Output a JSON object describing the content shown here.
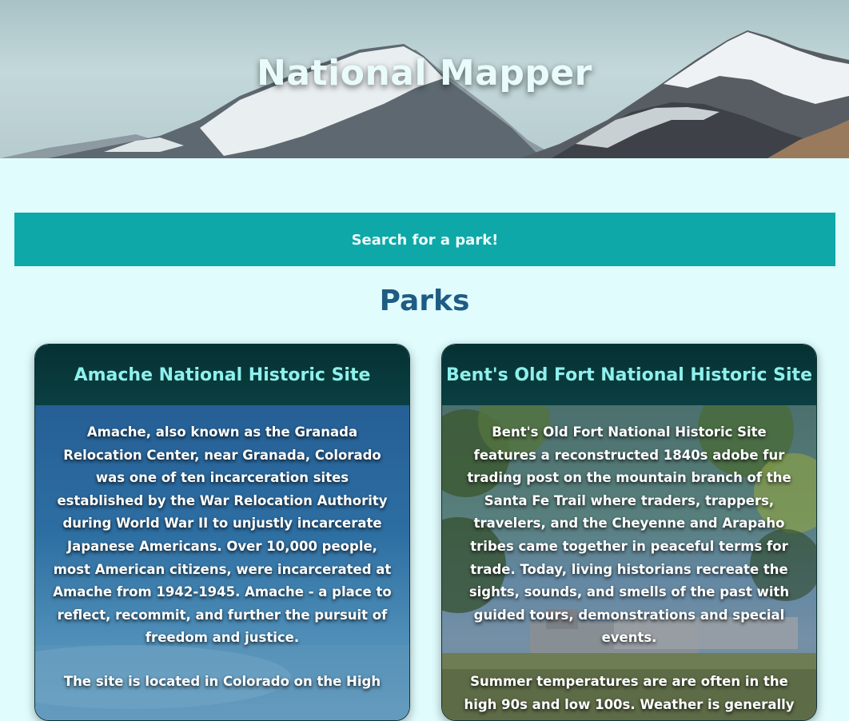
{
  "header": {
    "title": "National Mapper"
  },
  "search": {
    "label": "Search for a park!"
  },
  "parks_section": {
    "heading": "Parks"
  },
  "parks": [
    {
      "name": "Amache National Historic Site",
      "paragraphs": [
        "Amache, also known as the Granada Relocation Center, near Granada, Colorado was one of ten incarceration sites established by the War Relocation Authority during World War II to unjustly incarcerate Japanese Americans. Over 10,000 people, most American citizens, were incarcerated at Amache from 1942-1945. Amache - a place to reflect, recommit, and further the pursuit of freedom and justice.",
        "The site is located in Colorado on the High"
      ]
    },
    {
      "name": "Bent's Old Fort National Historic Site",
      "paragraphs": [
        "Bent's Old Fort National Historic Site features a reconstructed 1840s adobe fur trading post on the mountain branch of the Santa Fe Trail where traders, trappers, travelers, and the Cheyenne and Arapaho tribes came together in peaceful terms for trade. Today, living historians recreate the sights, sounds, and smells of the past with guided tours, demonstrations and special events.",
        "Summer temperatures are are often in the high 90s and low 100s. Weather is generally"
      ]
    }
  ],
  "colors": {
    "page_bg": "#e0fcfd",
    "search_bg": "#0da8a7",
    "section_heading": "#1f5c84",
    "card_header_bg": "#063133",
    "card_title": "#8ff0ec"
  }
}
